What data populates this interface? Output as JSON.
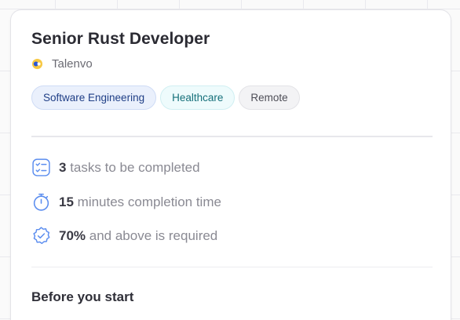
{
  "job": {
    "title": "Senior Rust Developer",
    "company": "Talenvo"
  },
  "tags": [
    {
      "label": "Software Engineering",
      "color": "#1f3e86"
    },
    {
      "label": "Healthcare",
      "color": "#15707a"
    },
    {
      "label": "Remote",
      "color": "#4e4e57"
    }
  ],
  "stats": {
    "tasks": {
      "value": "3",
      "text": "tasks to be completed",
      "icon": "task-list-icon"
    },
    "time": {
      "value": "15",
      "text": "minutes completion time",
      "icon": "stopwatch-icon"
    },
    "score": {
      "value": "70%",
      "text": "and above is required",
      "icon": "verified-badge-icon"
    }
  },
  "section": {
    "before_start": "Before you start"
  },
  "colors": {
    "icon_accent": "#5b8def",
    "title": "#2b2b33"
  }
}
